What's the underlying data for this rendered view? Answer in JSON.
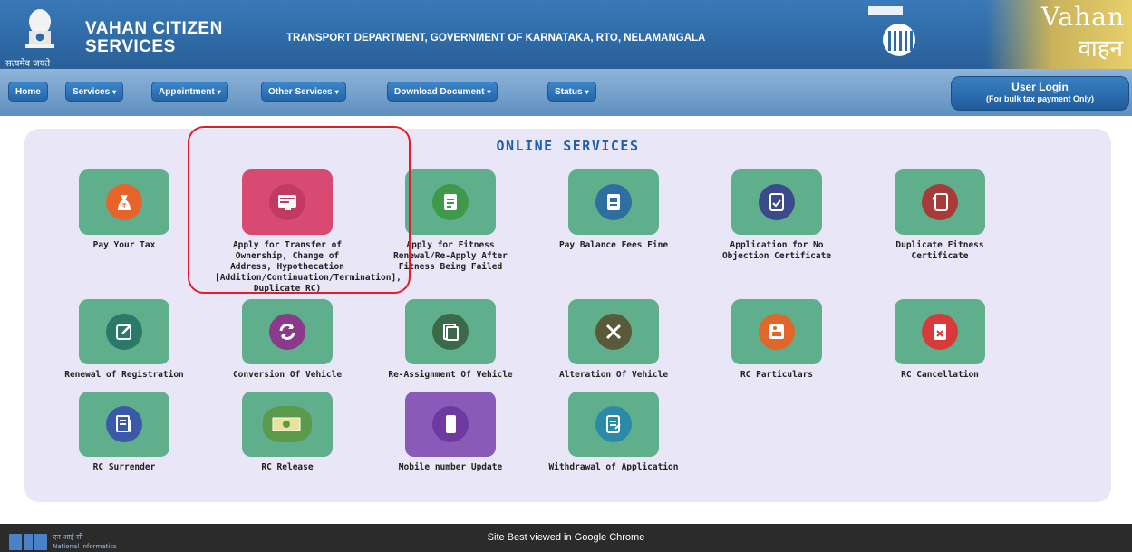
{
  "header": {
    "emblem_caption": "सत्यमेव जयते",
    "brand_line1": "VAHAN CITIZEN",
    "brand_line2": "SERVICES",
    "department": "TRANSPORT DEPARTMENT, GOVERNMENT OF KARNATAKA, RTO, NELAMANGALA",
    "vahan_logo_text": "Vahan",
    "vahan_logo_script": "वाहन"
  },
  "nav": {
    "items": [
      {
        "label": "Home",
        "has_caret": false
      },
      {
        "label": "Services",
        "has_caret": true
      },
      {
        "label": "Appointment",
        "has_caret": true
      },
      {
        "label": "Other Services",
        "has_caret": true
      },
      {
        "label": "Download Document",
        "has_caret": true
      },
      {
        "label": "Status",
        "has_caret": true
      }
    ],
    "caret": "▾",
    "login": {
      "label": "User Login",
      "sublabel": "(For bulk tax payment Only)"
    }
  },
  "panel": {
    "title": "ONLINE SERVICES",
    "tiles": [
      {
        "label": "Pay Your Tax",
        "icon": "money-bag-icon",
        "color": "#e8632a"
      },
      {
        "label": "Apply for Transfer of Ownership, Change of Address, Hypothecation [Addition/Continuation/Termination], Duplicate RC)",
        "icon": "certificate-card-icon",
        "color": "#d8406a"
      },
      {
        "label": "Apply for Fitness Renewal/Re-Apply After Fitness Being Failed",
        "icon": "document-icon",
        "color": "#3e9a4a"
      },
      {
        "label": "Pay Balance Fees Fine",
        "icon": "receipt-icon",
        "color": "#2f6fa0"
      },
      {
        "label": "Application for No Objection Certificate",
        "icon": "certificate-check-icon",
        "color": "#3a4a8a"
      },
      {
        "label": "Duplicate Fitness Certificate",
        "icon": "fitness-certificate-icon",
        "color": "#a83a3a"
      },
      {
        "label": "Renewal of Registration",
        "icon": "edit-form-icon",
        "color": "#2a7a6a"
      },
      {
        "label": "Conversion Of Vehicle",
        "icon": "refresh-icon",
        "color": "#8a3a8a"
      },
      {
        "label": "Re-Assignment Of Vehicle",
        "icon": "reassign-document-icon",
        "color": "#3a6a4a"
      },
      {
        "label": "Alteration Of Vehicle",
        "icon": "tools-icon",
        "color": "#5a5a3a"
      },
      {
        "label": "RC Particulars",
        "icon": "rc-card-icon",
        "color": "#e0662a"
      },
      {
        "label": "RC Cancellation",
        "icon": "cancel-document-icon",
        "color": "#d83a3a"
      },
      {
        "label": "RC Surrender",
        "icon": "surrender-document-icon",
        "color": "#3a5aa8"
      },
      {
        "label": "RC Release",
        "icon": "money-notes-icon",
        "color": "#5a9a4a"
      },
      {
        "label": "Mobile number Update",
        "icon": "mobile-phone-icon",
        "color": "#8a4aa8"
      },
      {
        "label": "Withdrawal of Application",
        "icon": "withdraw-document-icon",
        "color": "#2a8aa8"
      }
    ]
  },
  "footer": {
    "nic_hindi": "एन आई सी",
    "nic_text": "National Informatics",
    "message": "Site Best viewed in Google Chrome"
  }
}
